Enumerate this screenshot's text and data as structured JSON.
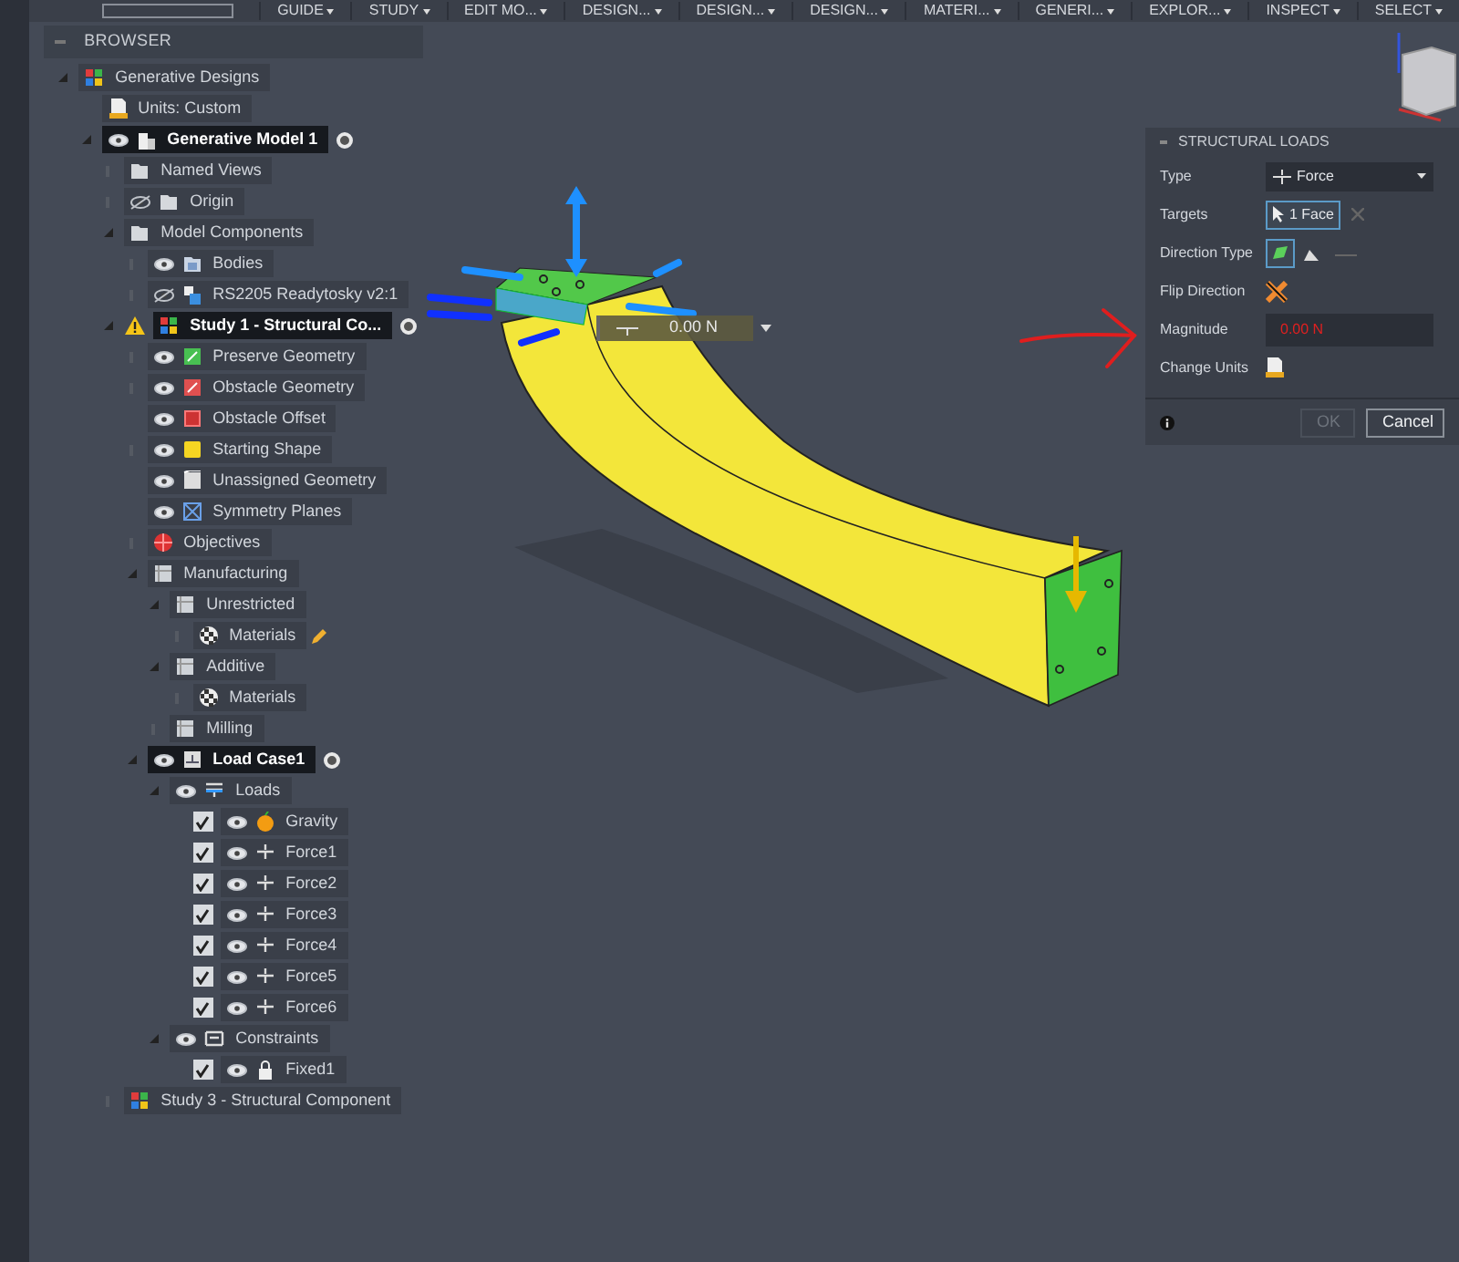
{
  "toolbar": {
    "menus": [
      {
        "label": "GUIDE"
      },
      {
        "label": "STUDY"
      },
      {
        "label": "EDIT MO..."
      },
      {
        "label": "DESIGN..."
      },
      {
        "label": "DESIGN..."
      },
      {
        "label": "DESIGN..."
      },
      {
        "label": "MATERI..."
      },
      {
        "label": "GENERI..."
      },
      {
        "label": "EXPLOR..."
      },
      {
        "label": "INSPECT"
      },
      {
        "label": "SELECT"
      }
    ]
  },
  "browser": {
    "title": "BROWSER",
    "items": [
      {
        "label": "Generative Designs",
        "kind": "generative",
        "expanded": true,
        "children": [
          {
            "label": "Units: Custom",
            "kind": "document"
          },
          {
            "label": "Generative Model 1",
            "kind": "component",
            "expanded": true,
            "visible": true,
            "active": true,
            "children": [
              {
                "label": "Named Views",
                "kind": "folder",
                "expanded": false
              },
              {
                "label": "Origin",
                "kind": "folder",
                "expanded": false,
                "visible": false
              },
              {
                "label": "Model Components",
                "kind": "folder",
                "expanded": true,
                "children": [
                  {
                    "label": "Bodies",
                    "kind": "body",
                    "expanded": false,
                    "visible": true
                  },
                  {
                    "label": "RS2205 Readytosky v2:1",
                    "kind": "assembly",
                    "expanded": false,
                    "visible": false
                  }
                ]
              },
              {
                "label": "Study 1 - Structural Co...",
                "kind": "generative",
                "expanded": true,
                "warning": true,
                "active": true,
                "children": [
                  {
                    "label": "Preserve Geometry",
                    "kind": "preserve",
                    "expanded": false,
                    "visible": true
                  },
                  {
                    "label": "Obstacle Geometry",
                    "kind": "obstacle",
                    "expanded": false,
                    "visible": true
                  },
                  {
                    "label": "Obstacle Offset",
                    "kind": "offset",
                    "visible": true
                  },
                  {
                    "label": "Starting Shape",
                    "kind": "shape",
                    "expanded": false,
                    "visible": true
                  },
                  {
                    "label": "Unassigned Geometry",
                    "kind": "unassigned",
                    "visible": true
                  },
                  {
                    "label": "Symmetry Planes",
                    "kind": "symmetry",
                    "visible": true
                  },
                  {
                    "label": "Objectives",
                    "kind": "objectives",
                    "expanded": false
                  },
                  {
                    "label": "Manufacturing",
                    "kind": "manufacturing",
                    "expanded": true,
                    "children": [
                      {
                        "label": "Unrestricted",
                        "kind": "manufacturing",
                        "expanded": true,
                        "children": [
                          {
                            "label": "Materials",
                            "kind": "material",
                            "expanded": false,
                            "editable": true
                          }
                        ]
                      },
                      {
                        "label": "Additive",
                        "kind": "manufacturing",
                        "expanded": true,
                        "children": [
                          {
                            "label": "Materials",
                            "kind": "material",
                            "expanded": false
                          }
                        ]
                      },
                      {
                        "label": "Milling",
                        "kind": "manufacturing",
                        "expanded": false
                      }
                    ]
                  },
                  {
                    "label": "Load Case1",
                    "kind": "loadcase",
                    "expanded": true,
                    "visible": true,
                    "active": true,
                    "children": [
                      {
                        "label": "Loads",
                        "kind": "load",
                        "expanded": true,
                        "visible": true,
                        "children": [
                          {
                            "label": "Gravity",
                            "kind": "gravity",
                            "checked": true,
                            "visible": true
                          },
                          {
                            "label": "Force1",
                            "kind": "force",
                            "checked": true,
                            "visible": true
                          },
                          {
                            "label": "Force2",
                            "kind": "force",
                            "checked": true,
                            "visible": true
                          },
                          {
                            "label": "Force3",
                            "kind": "force",
                            "checked": true,
                            "visible": true
                          },
                          {
                            "label": "Force4",
                            "kind": "force",
                            "checked": true,
                            "visible": true
                          },
                          {
                            "label": "Force5",
                            "kind": "force",
                            "checked": true,
                            "visible": true
                          },
                          {
                            "label": "Force6",
                            "kind": "force",
                            "checked": true,
                            "visible": true
                          }
                        ]
                      },
                      {
                        "label": "Constraints",
                        "kind": "constraint",
                        "expanded": true,
                        "visible": true,
                        "children": [
                          {
                            "label": "Fixed1",
                            "kind": "lock",
                            "checked": true,
                            "visible": true
                          }
                        ]
                      }
                    ]
                  }
                ]
              },
              {
                "label": "Study 3 - Structural Component",
                "kind": "generative",
                "expanded": false
              }
            ]
          }
        ]
      }
    ]
  },
  "viewport": {
    "inline_input": {
      "value": "0.00 N"
    }
  },
  "structural_loads": {
    "title": "STRUCTURAL LOADS",
    "rows": [
      {
        "kind": "dropdown",
        "label": "Type",
        "value": "Force"
      },
      {
        "kind": "selection",
        "label": "Targets",
        "value": "1 Face",
        "selected": true
      },
      {
        "kind": "icon_choice",
        "label": "Direction Type",
        "options": [
          {
            "selected": true
          },
          {
            "selected": false
          },
          {
            "selected": false
          }
        ]
      },
      {
        "kind": "icon_button",
        "label": "Flip Direction"
      },
      {
        "kind": "input",
        "label": "Magnitude",
        "value": "0.00 N",
        "error": true
      },
      {
        "kind": "units",
        "label": "Change Units"
      }
    ],
    "buttons": [
      {
        "label": "OK",
        "disabled": true
      },
      {
        "label": "Cancel",
        "disabled": false
      }
    ]
  }
}
